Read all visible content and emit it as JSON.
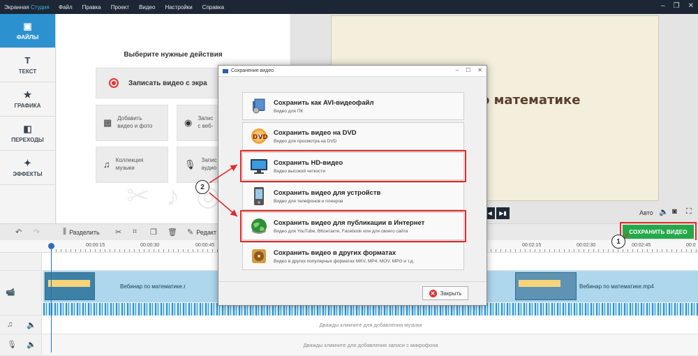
{
  "app": {
    "name_part1": "Экранная ",
    "name_part2": "Студия"
  },
  "menu": [
    "Файл",
    "Правка",
    "Проект",
    "Видео",
    "Настройки",
    "Справка"
  ],
  "left_tabs": [
    {
      "label": "ФАЙЛЫ",
      "icon": "folder-icon",
      "active": true
    },
    {
      "label": "ТЕКСТ",
      "icon": "text-icon"
    },
    {
      "label": "ГРАФИКА",
      "icon": "star-icon"
    },
    {
      "label": "ПЕРЕХОДЫ",
      "icon": "transitions-icon"
    },
    {
      "label": "ЭФФЕКТЫ",
      "icon": "magic-wand-icon"
    }
  ],
  "actions": {
    "heading": "Выберите нужные действия",
    "record": "Записать видео с экра",
    "add_media": "Добавить\nвидео и фото",
    "webcam": "Запис\nс веб-",
    "music": "Коллекция\nмузыки",
    "voice": "Запис\nаудио"
  },
  "preview": {
    "title": "о математике",
    "auto": "Авто"
  },
  "toolbar": {
    "split": "Разделить",
    "edit": "Редакт",
    "save_video": "СОХРАНИТЬ ВИДЕО"
  },
  "timeline": {
    "ticks": [
      "00:00:15",
      "00:00:30",
      "00:00:45",
      "00:02:15",
      "00:02:30",
      "00:02:45",
      "00:0"
    ],
    "clip_name_1": "Вебинар по математике.r",
    "clip_name_2": "Вебинар по математике.mp4",
    "music_hint": "Дважды кликните для добавления музыки",
    "mic_hint": "Дважды кликните для добавления записи с микрофона"
  },
  "dialog": {
    "title": "Сохранение видео",
    "options": [
      {
        "title": "Сохранить как AVI-видеофайл",
        "desc": "Видео для ПК",
        "icon": "avi-file-icon"
      },
      {
        "title": "Сохранить видео на DVD",
        "desc": "Видео для просмотра на DVD",
        "icon": "dvd-icon"
      },
      {
        "title": "Сохранить HD-видео",
        "desc": "Видео высокой четкости",
        "icon": "hd-monitor-icon"
      },
      {
        "title": "Сохранить видео для устройств",
        "desc": "Видео для телефонов и плееров",
        "icon": "phone-icon"
      },
      {
        "title": "Сохранить видео для публикации в Интернет",
        "desc": "Видео для YouTube, ВКонтакте, Facebook или для своего сайта",
        "icon": "globe-icon"
      },
      {
        "title": "Сохранить видео в других форматах",
        "desc": "Видео в других популярных форматах MKV, MP4, MOV, MPG и т.д.",
        "icon": "film-reel-icon"
      }
    ],
    "close_label": "Закрыть"
  },
  "callouts": {
    "one": "1",
    "two": "2"
  },
  "colors": {
    "accent_blue": "#2b92cf",
    "save_green": "#24a84a",
    "highlight_red": "#e12a2a",
    "titlebar": "#1c2634"
  }
}
